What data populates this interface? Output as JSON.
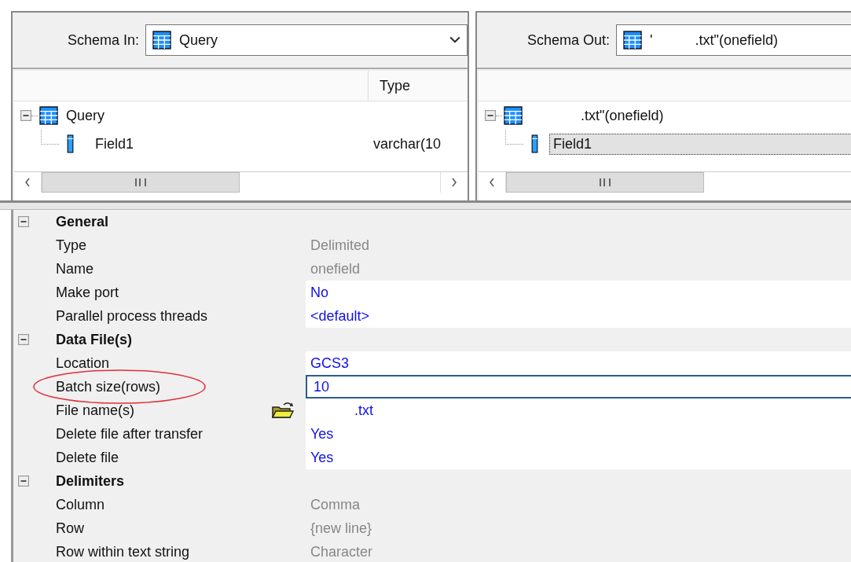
{
  "schema_in": {
    "label": "Schema In:",
    "value": "Query"
  },
  "input_tree": {
    "columns": [
      "Type"
    ],
    "nodes": [
      {
        "label": "Query",
        "expanded": true,
        "children": [
          {
            "label": "Field1",
            "type": "varchar(10",
            "selected": false
          }
        ]
      }
    ]
  },
  "schema_out": {
    "label": "Schema Out:",
    "value_parts": [
      "'",
      ".txt\"(onefield)"
    ]
  },
  "output_tree": {
    "nodes": [
      {
        "label": ".txt\"(onefield)",
        "expanded": true,
        "children": [
          {
            "label": "Field1",
            "selected": true
          }
        ]
      }
    ]
  },
  "properties": [
    {
      "label": "General",
      "expanded": true,
      "rows": [
        {
          "label": "Type",
          "value": "Delimited",
          "kind": "readonly",
          "highlighted": false
        },
        {
          "label": "Name",
          "value": "onefield",
          "kind": "readonly",
          "highlighted": false
        },
        {
          "label": "Make port",
          "value": "No",
          "kind": "editable",
          "highlighted": false
        },
        {
          "label": "Parallel process threads",
          "value": "<default>",
          "kind": "editable",
          "highlighted": false
        }
      ]
    },
    {
      "label": "Data File(s)",
      "expanded": true,
      "rows": [
        {
          "label": "Location",
          "value": "GCS3",
          "kind": "editable",
          "highlighted": false
        },
        {
          "label": "Batch size(rows)",
          "value": "10",
          "kind": "editing",
          "highlighted": true
        },
        {
          "label": "File name(s)",
          "value": ".txt",
          "kind": "browse",
          "highlighted": false
        },
        {
          "label": "Delete file after transfer",
          "value": "Yes",
          "kind": "editable",
          "highlighted": false
        },
        {
          "label": "Delete file",
          "value": "Yes",
          "kind": "editable",
          "highlighted": false
        }
      ]
    },
    {
      "label": "Delimiters",
      "expanded": true,
      "rows": [
        {
          "label": "Column",
          "value": "Comma",
          "kind": "readonly",
          "highlighted": false
        },
        {
          "label": "Row",
          "value": "{new line}",
          "kind": "readonly",
          "highlighted": false
        },
        {
          "label": "Row within text string",
          "value": "Character",
          "kind": "readonly",
          "highlighted": false
        }
      ]
    }
  ]
}
